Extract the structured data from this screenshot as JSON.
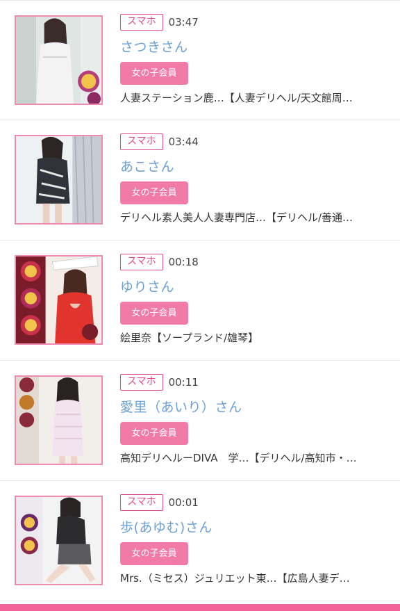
{
  "entries": [
    {
      "device": "スマホ",
      "time": "03:47",
      "name": "さつきさん",
      "member_badge": "女の子会員",
      "shop": "人妻ステーション鹿…【人妻デリヘル/天文館周…",
      "thumb_icon": "profile-photo"
    },
    {
      "device": "スマホ",
      "time": "03:44",
      "name": "あこさん",
      "member_badge": "女の子会員",
      "shop": "デリヘル素人美人人妻専門店…【デリヘル/善通…",
      "thumb_icon": "profile-photo"
    },
    {
      "device": "スマホ",
      "time": "00:18",
      "name": "ゆりさん",
      "member_badge": "女の子会員",
      "shop": "絵里奈【ソープランド/雄琴】",
      "thumb_icon": "profile-photo"
    },
    {
      "device": "スマホ",
      "time": "00:11",
      "name": "愛里（あいり）さん",
      "member_badge": "女の子会員",
      "shop": "高知デリヘルーDIVA　学…【デリヘル/高知市・…",
      "thumb_icon": "profile-photo"
    },
    {
      "device": "スマホ",
      "time": "00:01",
      "name": "歩(あゆむ)さん",
      "member_badge": "女の子会員",
      "shop": "Mrs.（ミセス）ジュリエット東…【広島人妻デ…",
      "thumb_icon": "profile-photo"
    }
  ],
  "colors": {
    "accent_pink": "#e14a8a",
    "badge_pink": "#f27aa6",
    "name_blue": "#6a9fd6",
    "bottom_bar": "#f0649a"
  }
}
